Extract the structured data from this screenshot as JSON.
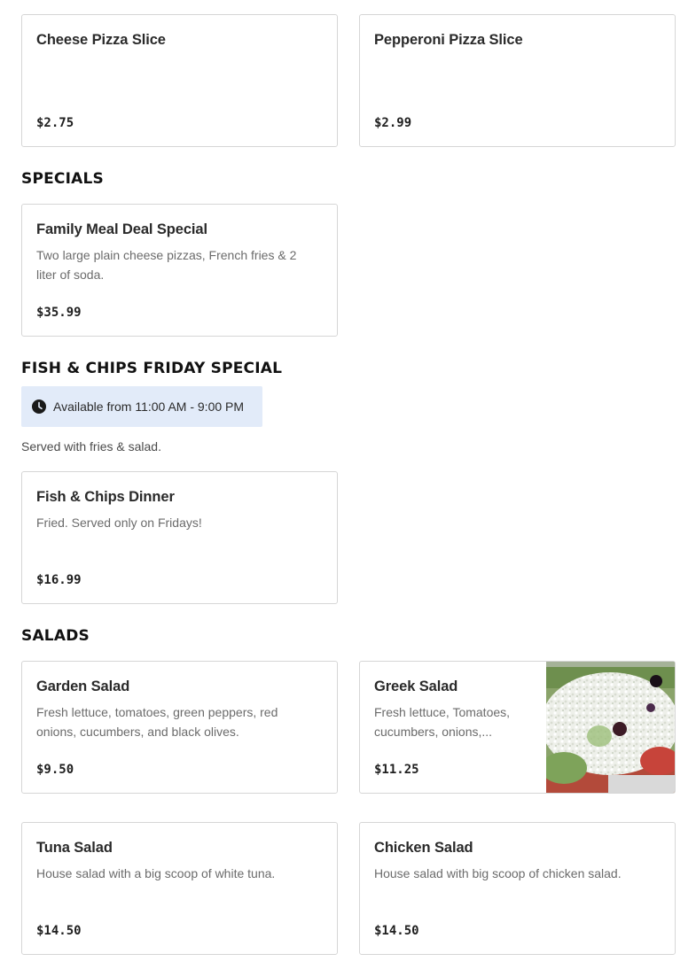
{
  "pizza_slices": {
    "items": [
      {
        "name": "Cheese Pizza Slice",
        "description": "",
        "price": "$2.75"
      },
      {
        "name": "Pepperoni Pizza Slice",
        "description": "",
        "price": "$2.99"
      }
    ]
  },
  "specials": {
    "title": "SPECIALS",
    "items": [
      {
        "name": "Family Meal Deal Special",
        "description": "Two large plain cheese pizzas, French fries & 2 liter of soda.",
        "price": "$35.99"
      }
    ]
  },
  "fish_chips": {
    "title": "FISH & CHIPS FRIDAY SPECIAL",
    "availability": "Available from 11:00 AM - 9:00 PM",
    "availability_icon": "clock-icon",
    "note": "Served with fries & salad.",
    "items": [
      {
        "name": "Fish & Chips Dinner",
        "description": "Fried. Served only on Fridays!",
        "price": "$16.99"
      }
    ]
  },
  "salads": {
    "title": "SALADS",
    "items": [
      {
        "name": "Garden Salad",
        "description": "Fresh lettuce, tomatoes, green peppers, red onions, cucumbers, and black olives.",
        "price": "$9.50"
      },
      {
        "name": "Greek Salad",
        "description": "Fresh lettuce, Tomatoes, cucumbers, onions,...",
        "price": "$11.25",
        "has_image": true
      },
      {
        "name": "Tuna Salad",
        "description": "House salad with a big scoop of white tuna.",
        "price": "$14.50"
      },
      {
        "name": "Chicken Salad",
        "description": "House salad with big scoop of chicken salad.",
        "price": "$14.50"
      }
    ]
  },
  "colors": {
    "badge_background": "#e2ebf9",
    "card_border": "#d6d6d6",
    "description_text": "#6b6b6b"
  }
}
